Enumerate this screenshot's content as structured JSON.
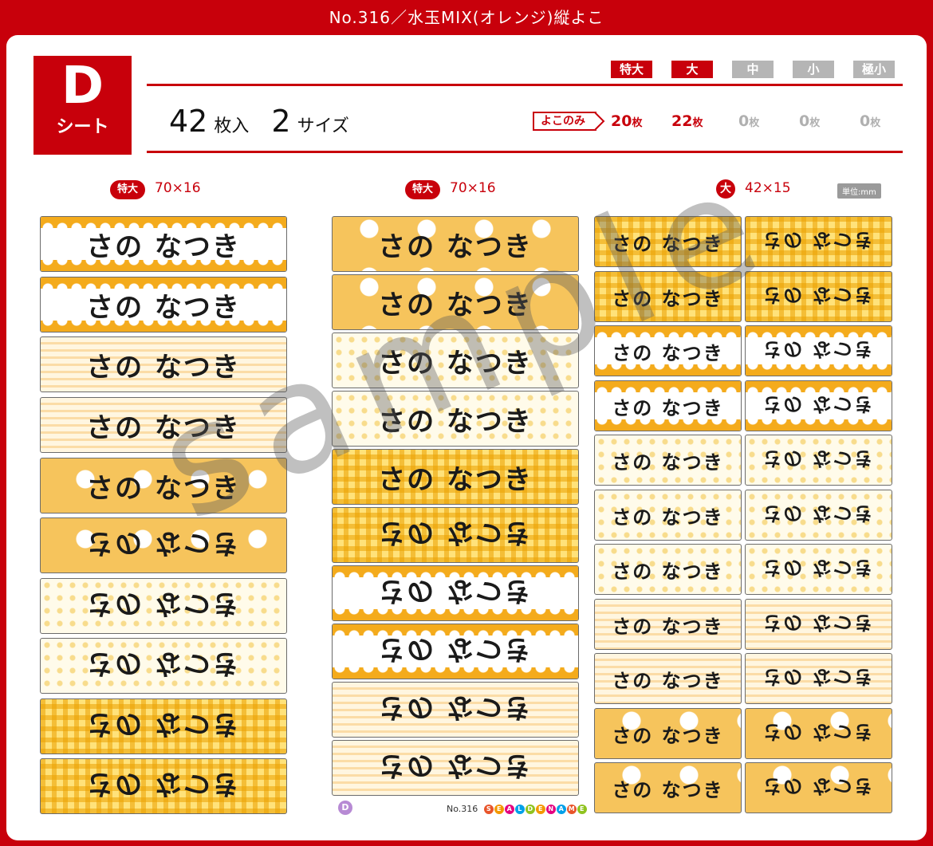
{
  "title": "No.316／水玉MIX(オレンジ)縦よこ",
  "badge": {
    "letter": "D",
    "label": "シート"
  },
  "size_tags": [
    "特大",
    "大",
    "中",
    "小",
    "極小"
  ],
  "summary": {
    "count": "42",
    "count_unit": "枚入",
    "sizes": "2",
    "sizes_unit": "サイズ"
  },
  "yoko_label": "よこのみ",
  "counts": [
    {
      "value": "20",
      "unit": "枚"
    },
    {
      "value": "22",
      "unit": "枚"
    },
    {
      "value": "0",
      "unit": "枚"
    },
    {
      "value": "0",
      "unit": "枚"
    },
    {
      "value": "0",
      "unit": "枚"
    }
  ],
  "columns": [
    {
      "size": "特大",
      "dims": "70×16"
    },
    {
      "size": "特大",
      "dims": "70×16"
    },
    {
      "size": "大",
      "dims": "42×15"
    }
  ],
  "unit_note": "単位:mm",
  "label_text": "さの なつき",
  "watermark": "sample",
  "footer": {
    "sheet_letter": "D",
    "product_no": "No.316",
    "brand_letters": [
      "S",
      "E",
      "A",
      "L",
      "D",
      "E",
      "N",
      "A",
      "M",
      "E"
    ]
  },
  "colors": {
    "accent": "#c8000b",
    "inactive": "#b5b5b5",
    "orange": "#f4ab1c"
  }
}
